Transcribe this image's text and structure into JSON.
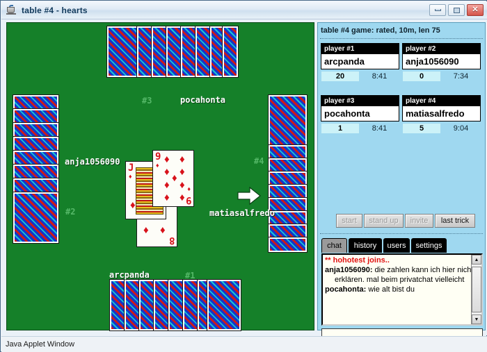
{
  "window": {
    "title": "table #4 - hearts",
    "icon": "java-coffee-cup-icon",
    "minimize_label": "",
    "maximize_label": "",
    "close_label": "✕"
  },
  "statusbar": {
    "text": "Java Applet Window"
  },
  "side": {
    "header": "table #4  game: rated, 10m, len 75",
    "players": [
      {
        "seat": "player #1",
        "name": "arcpanda",
        "score": "20",
        "time": "8:41"
      },
      {
        "seat": "player #2",
        "name": "anja1056090",
        "score": "0",
        "time": "7:34"
      },
      {
        "seat": "player #3",
        "name": "pocahonta",
        "score": "1",
        "time": "8:41"
      },
      {
        "seat": "player #4",
        "name": "matiasalfredo",
        "score": "5",
        "time": "9:04"
      }
    ],
    "actions": [
      {
        "label": "start",
        "enabled": false
      },
      {
        "label": "stand up",
        "enabled": false
      },
      {
        "label": "invite",
        "enabled": false
      },
      {
        "label": "last trick",
        "enabled": true
      }
    ],
    "tabs": [
      {
        "label": "chat",
        "active": true
      },
      {
        "label": "history",
        "active": false
      },
      {
        "label": "users",
        "active": false
      },
      {
        "label": "settings",
        "active": false
      }
    ],
    "chat": {
      "messages": [
        {
          "type": "system",
          "text": "** hohotest joins.."
        },
        {
          "type": "message",
          "who": "anja1056090:",
          "text": " die zahlen kann ich hier nicht"
        },
        {
          "type": "continuation",
          "text": "erklären. mal beim privatchat vielleicht"
        },
        {
          "type": "message",
          "who": "pocahonta:",
          "text": " wie alt bist du"
        }
      ],
      "input_value": "",
      "input_placeholder": "",
      "scroll_up": "▲",
      "scroll_down": "▼"
    },
    "colors": {
      "panel_bg": "#9fd8f0",
      "score_bg": "#ccf2f8",
      "header_bar": "#000000",
      "system_msg": "#e01010"
    }
  },
  "table": {
    "felt_color": "#158029",
    "seats": [
      {
        "num": "#1",
        "name": "arcpanda",
        "position": "bottom",
        "cards": 8,
        "active": false
      },
      {
        "num": "#2",
        "name": "anja1056090",
        "position": "left",
        "cards": 8,
        "active": false
      },
      {
        "num": "#3",
        "name": "pocahonta",
        "position": "top",
        "cards": 8,
        "active": false
      },
      {
        "num": "#4",
        "name": "matiasalfredo",
        "position": "right",
        "cards": 9,
        "active": true
      }
    ],
    "turn_indicator": {
      "icon": "right-arrow-icon",
      "points_to": "#4"
    },
    "played_cards": [
      {
        "rank": "J",
        "suit": "diamonds",
        "player": "#2",
        "face": "court"
      },
      {
        "rank": "9",
        "suit": "diamonds",
        "player": "#3",
        "face": "pips"
      },
      {
        "rank": "8",
        "suit": "diamonds",
        "player": "#1",
        "face": "pips"
      }
    ],
    "suit_glyph": "♦"
  }
}
